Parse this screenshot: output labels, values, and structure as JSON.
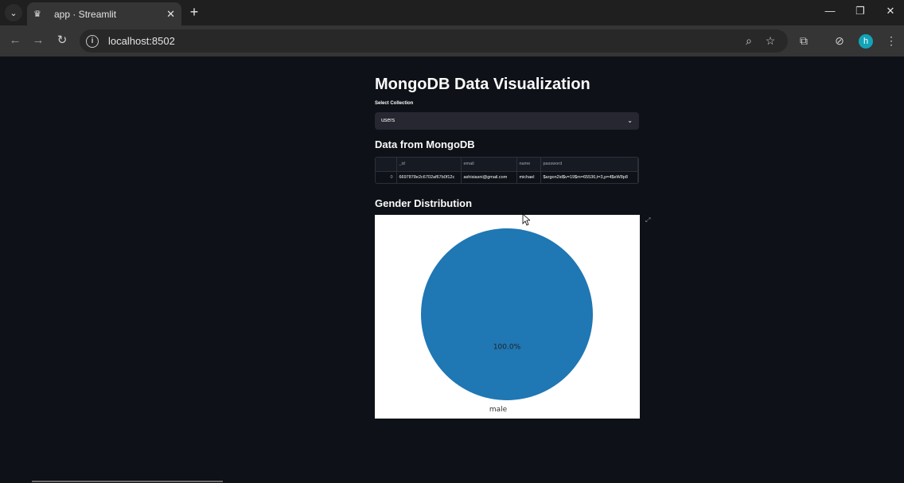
{
  "browser": {
    "tab_title": "app · Streamlit",
    "url": "localhost:8502",
    "profile_initial": "h"
  },
  "app": {
    "title": "MongoDB Data Visualization",
    "select_label": "Select Collection",
    "selected_collection": "users",
    "data_heading": "Data from MongoDB",
    "chart_heading": "Gender Distribution"
  },
  "table": {
    "columns": [
      "",
      "_id",
      "email",
      "name",
      "password"
    ],
    "rows": [
      [
        "0",
        "6697878e2c6702af67b0f12c",
        "ashisiasni@gmail.com",
        "michael",
        "$argon2id$v=19$m=65536,t=3,p=4$eW8p8"
      ]
    ]
  },
  "chart_data": {
    "type": "pie",
    "categories": [
      "male"
    ],
    "values": [
      100.0
    ],
    "data_labels": [
      "100.0%"
    ],
    "colors": [
      "#1f77b4"
    ],
    "title": ""
  }
}
